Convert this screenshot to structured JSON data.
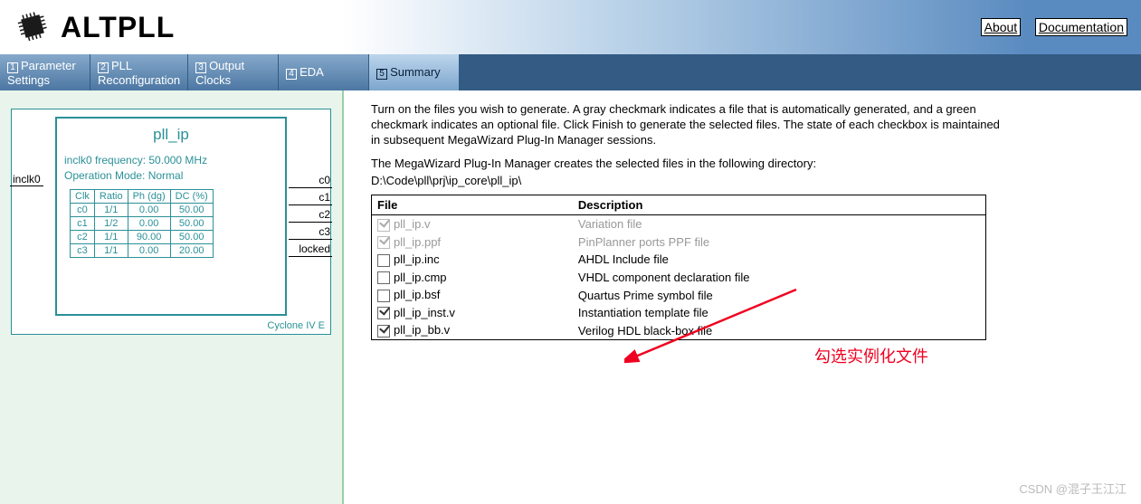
{
  "header": {
    "title": "ALTPLL",
    "links": {
      "about": "About",
      "docs": "Documentation"
    }
  },
  "tabs": [
    {
      "num": "1",
      "label1": "Parameter",
      "label2": "Settings"
    },
    {
      "num": "2",
      "label1": "PLL",
      "label2": "Reconfiguration"
    },
    {
      "num": "3",
      "label1": "Output",
      "label2": "Clocks"
    },
    {
      "num": "4",
      "label1": "EDA",
      "label2": ""
    },
    {
      "num": "5",
      "label1": "Summary",
      "label2": ""
    }
  ],
  "active_tab": 4,
  "preview": {
    "module_name": "pll_ip",
    "freq_line": "inclk0 frequency: 50.000 MHz",
    "mode_line": "Operation Mode: Normal",
    "input_port": "inclk0",
    "output_ports": [
      "c0",
      "c1",
      "c2",
      "c3",
      "locked"
    ],
    "device": "Cyclone IV E",
    "clk_table": {
      "headers": [
        "Clk",
        "Ratio",
        "Ph (dg)",
        "DC (%)"
      ],
      "rows": [
        [
          "c0",
          "1/1",
          "0.00",
          "50.00"
        ],
        [
          "c1",
          "1/2",
          "0.00",
          "50.00"
        ],
        [
          "c2",
          "1/1",
          "90.00",
          "50.00"
        ],
        [
          "c3",
          "1/1",
          "0.00",
          "20.00"
        ]
      ]
    }
  },
  "main": {
    "instruction": "Turn on the files you wish to generate. A gray checkmark indicates a file that is automatically generated, and a green checkmark indicates an optional file. Click Finish to generate the selected files. The state of each checkbox is maintained in subsequent MegaWizard Plug-In Manager sessions.",
    "dir_label": "The MegaWizard Plug-In Manager creates the selected files in the following directory:",
    "dir_path": "D:\\Code\\pll\\prj\\ip_core\\pll_ip\\",
    "col_file": "File",
    "col_desc": "Description",
    "files": [
      {
        "name": "pll_ip.v",
        "desc": "Variation file",
        "checked": true,
        "disabled": true
      },
      {
        "name": "pll_ip.ppf",
        "desc": "PinPlanner ports PPF file",
        "checked": true,
        "disabled": true
      },
      {
        "name": "pll_ip.inc",
        "desc": "AHDL Include file",
        "checked": false,
        "disabled": false
      },
      {
        "name": "pll_ip.cmp",
        "desc": "VHDL component declaration file",
        "checked": false,
        "disabled": false
      },
      {
        "name": "pll_ip.bsf",
        "desc": "Quartus Prime symbol file",
        "checked": false,
        "disabled": false
      },
      {
        "name": "pll_ip_inst.v",
        "desc": "Instantiation template file",
        "checked": true,
        "disabled": false
      },
      {
        "name": "pll_ip_bb.v",
        "desc": "Verilog HDL black-box file",
        "checked": true,
        "disabled": false
      }
    ]
  },
  "annotation": "勾选实例化文件",
  "watermark": "CSDN @混子王江江"
}
